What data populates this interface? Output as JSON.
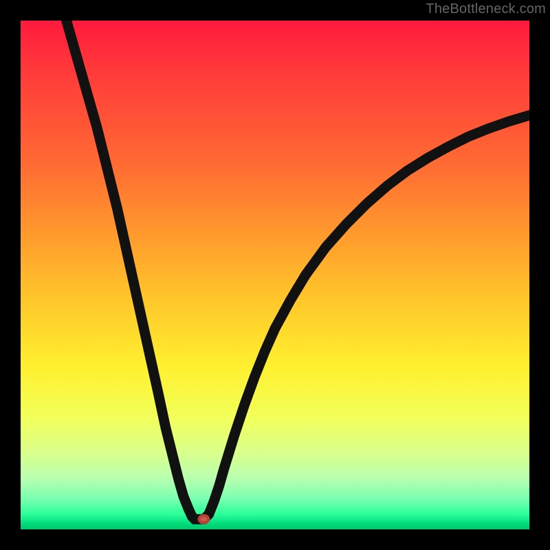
{
  "watermark": "TheBottleneck.com",
  "colors": {
    "curve": "#111111",
    "marker": "#cc5a4d"
  },
  "chart_data": {
    "type": "line",
    "title": "",
    "xlabel": "",
    "ylabel": "",
    "xlim": [
      0,
      100
    ],
    "ylim": [
      0,
      100
    ],
    "note": "x/y are normalized plot-area coordinates (0–100). y is plotted top-down (0 at top, 100 at bottom). Values estimated from pixels.",
    "curve_points": [
      [
        9,
        0
      ],
      [
        11,
        7
      ],
      [
        13,
        14
      ],
      [
        15,
        21
      ],
      [
        17,
        29
      ],
      [
        19,
        37
      ],
      [
        21,
        46
      ],
      [
        23,
        55
      ],
      [
        25,
        64
      ],
      [
        27,
        73
      ],
      [
        28.5,
        80
      ],
      [
        30,
        86
      ],
      [
        31,
        90
      ],
      [
        32,
        93.5
      ],
      [
        33,
        96
      ],
      [
        33.7,
        97.5
      ],
      [
        34.2,
        98
      ],
      [
        35,
        98
      ],
      [
        36,
        98
      ],
      [
        37,
        97
      ],
      [
        38,
        94.5
      ],
      [
        39,
        91.5
      ],
      [
        40,
        88
      ],
      [
        42,
        81.5
      ],
      [
        44,
        75.5
      ],
      [
        46,
        70
      ],
      [
        48,
        65
      ],
      [
        50,
        60.5
      ],
      [
        53,
        55
      ],
      [
        56,
        50
      ],
      [
        60,
        44.5
      ],
      [
        64,
        40
      ],
      [
        68,
        36
      ],
      [
        72,
        32.5
      ],
      [
        76,
        29.5
      ],
      [
        80,
        27
      ],
      [
        84,
        24.8
      ],
      [
        88,
        22.8
      ],
      [
        92,
        21.2
      ],
      [
        96,
        19.8
      ],
      [
        100,
        18.6
      ]
    ],
    "marker": {
      "x": 36,
      "y": 98
    }
  }
}
